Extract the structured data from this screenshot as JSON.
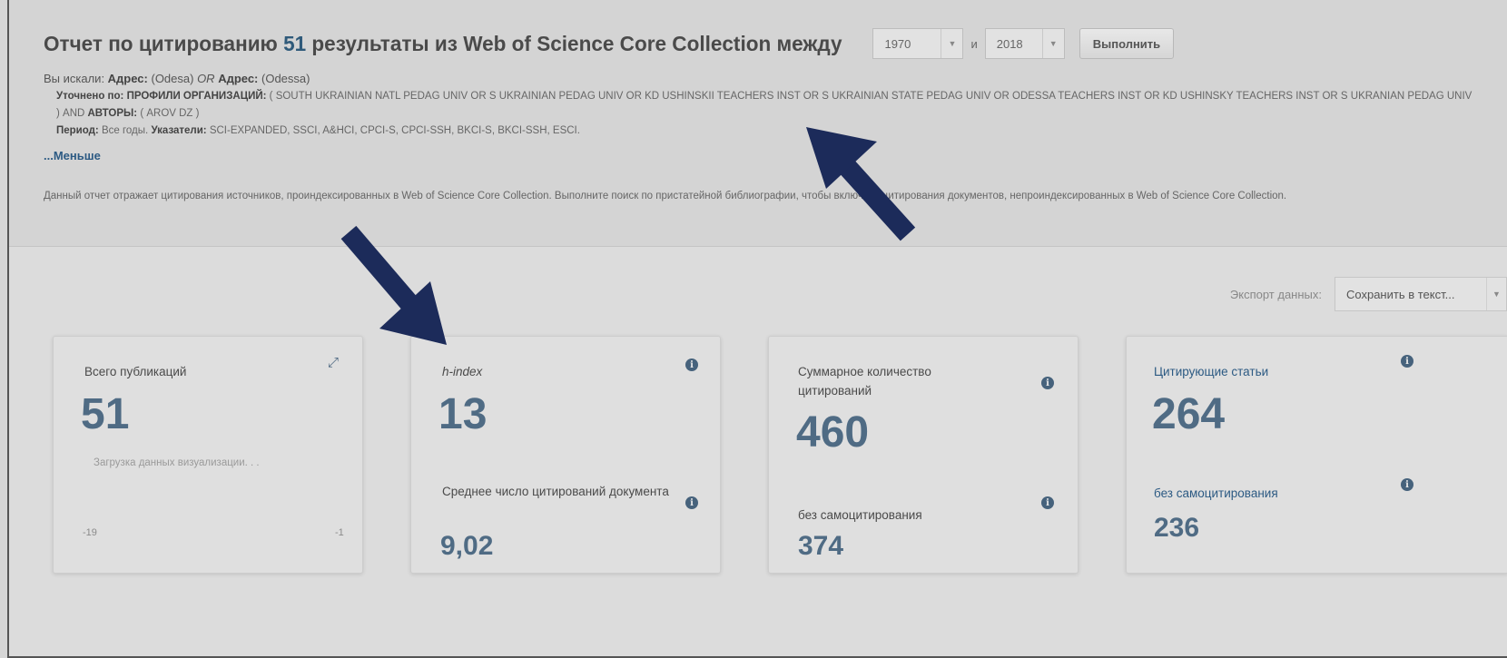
{
  "header": {
    "title_pre": "Отчет по цитированию ",
    "title_count": "51",
    "title_post": " результаты из Web of Science Core Collection  между",
    "year_from": "1970",
    "and_label": "и",
    "year_to": "2018",
    "run_button": "Выполнить"
  },
  "query": {
    "searched_label": "Вы искали: ",
    "field1": "Адрес:",
    "val1": " (Odesa) ",
    "op": "OR ",
    "field2": "Адрес:",
    "val2": " (Odessa)",
    "refined_label": "Уточнено по: ",
    "org_label": "ПРОФИЛИ ОРГАНИЗАЦИЙ:",
    "org_value": " ( SOUTH UKRAINIAN NATL PEDAG UNIV OR S UKRAINIAN PEDAG UNIV OR KD USHINSKII TEACHERS INST OR S UKRAINIAN STATE PEDAG UNIV OR ODESSA TEACHERS INST OR KD USHINSKY TEACHERS INST OR S UKRANIAN PEDAG UNIV ) AND ",
    "authors_label": "АВТОРЫ:",
    "authors_value": " ( AROV DZ )",
    "period_label": "Период:",
    "period_value": " Все годы. ",
    "indexes_label": "Указатели:",
    "indexes_value": " SCI-EXPANDED, SSCI, A&HCI, CPCI-S, CPCI-SSH, BKCI-S, BKCI-SSH, ESCI.",
    "less_link": "...Меньше",
    "note": "Данный отчет отражает цитирования источников, проиндексированных в Web of Science Core Collection. Выполните поиск по пристатейной библиографии, чтобы включить цитирования документов, непроиндексированных в Web of Science Core Collection."
  },
  "export": {
    "label": "Экспорт данных:",
    "option": "Сохранить в текст..."
  },
  "cards": {
    "total": {
      "label": "Всего публикаций",
      "value": "51",
      "loading": "Загрузка данных визуализации. . .",
      "axis_left": "-19",
      "axis_right": "-1"
    },
    "hindex": {
      "label": "h-index",
      "value": "13",
      "avg_label": "Среднее число цитирований документа",
      "avg_value": "9,02"
    },
    "citations": {
      "label": "Суммарное количество цитирований",
      "value": "460",
      "noself_label": "без самоцитирования",
      "noself_value": "374"
    },
    "citing": {
      "label": "Цитирующие статьи",
      "value": "264",
      "noself_label": "без самоцитирования",
      "noself_value": "236"
    }
  },
  "icons": {
    "info": "i",
    "expand": "⤢"
  },
  "colors": {
    "arrow": "#1c2b5a",
    "accent": "#2c5a83",
    "value": "#4f6b84"
  }
}
